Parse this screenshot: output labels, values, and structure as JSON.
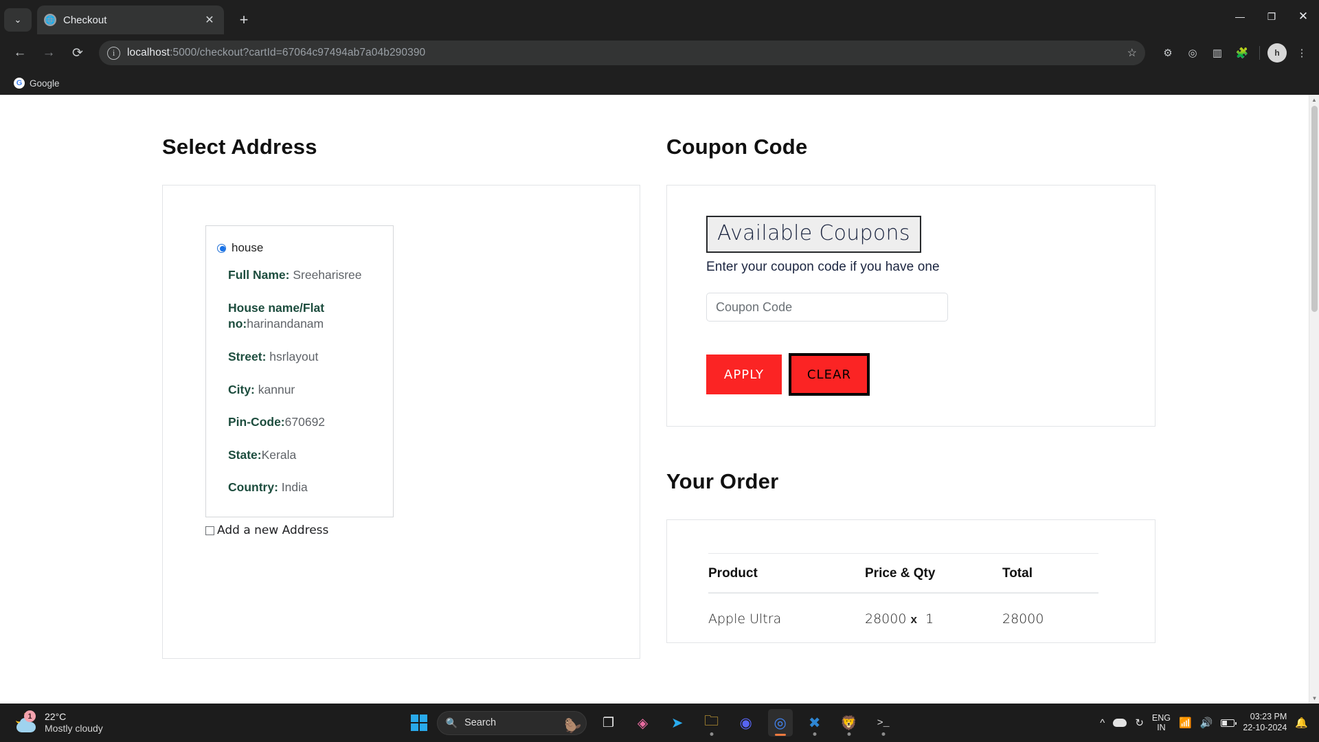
{
  "browser": {
    "tab": {
      "title": "Checkout",
      "favicon_icon": "globe-icon",
      "close_icon": "✕"
    },
    "tab_search_icon": "chevron-down-icon",
    "new_tab_icon": "+",
    "window_controls": {
      "minimize": "—",
      "maximize": "❐",
      "close": "✕"
    },
    "nav": {
      "back_icon": "←",
      "forward_icon": "→",
      "reload_icon": "⟳"
    },
    "omnibox": {
      "site_info_icon": "ⓘ",
      "url_host": "localhost",
      "url_rest": ":5000/checkout?cartId=67064c97494ab7a04b290390",
      "bookmark_star_icon": "☆"
    },
    "extensions": [
      "settings-gear-icon",
      "target-icon",
      "sidebar-icon",
      "puzzle-extensions-icon"
    ],
    "profile_initial": "h",
    "menu_icon": "⋮",
    "bookmarks": [
      {
        "label": "Google",
        "icon_letter": "G"
      }
    ]
  },
  "page": {
    "address": {
      "title": "Select Address",
      "option_label": "house",
      "selected": true,
      "fields": [
        {
          "label": "Full Name:",
          "value": " Sreeharisree"
        },
        {
          "label": "House name/Flat no:",
          "value": "harinandanam"
        },
        {
          "label": "Street:",
          "value": " hsrlayout"
        },
        {
          "label": "City:",
          "value": " kannur"
        },
        {
          "label": "Pin-Code:",
          "value": "670692"
        },
        {
          "label": "State:",
          "value": "Kerala"
        },
        {
          "label": "Country:",
          "value": " India"
        }
      ],
      "add_new_label": "Add a new Address",
      "add_new_checked": false
    },
    "coupon": {
      "title": "Coupon Code",
      "available_button": "Available Coupons",
      "hint": "Enter your coupon code if you have one",
      "input_value": "",
      "input_placeholder": "Coupon Code",
      "apply_label": "APPLY",
      "clear_label": "CLEAR",
      "apply_color": "#fb2424",
      "clear_color": "#fb2424"
    },
    "order": {
      "title": "Your Order",
      "columns": [
        "Product",
        "Price & Qty",
        "Total"
      ],
      "rows": [
        {
          "product": "Apple Ultra",
          "price": "28000",
          "x": "x",
          "qty": "1",
          "total": "28000"
        }
      ]
    }
  },
  "taskbar": {
    "weather": {
      "temp": "22°C",
      "condition": "Mostly cloudy",
      "badge": "1"
    },
    "start_icon": "windows-logo-icon",
    "search": {
      "placeholder": "Search",
      "icon": "search-icon",
      "mascot": "🦫"
    },
    "apps": [
      {
        "name": "task-view-icon",
        "glyph": "❐",
        "color": "#e8e8e8",
        "running": false
      },
      {
        "name": "microsoft-copilot-icon",
        "glyph": "◈",
        "color": "#f0a0c0",
        "running": false
      },
      {
        "name": "telegram-icon",
        "glyph": "➤",
        "color": "#2aabee",
        "running": false
      },
      {
        "name": "file-explorer-icon",
        "glyph": "🗀",
        "color": "#ffc83d",
        "running": true
      },
      {
        "name": "discord-icon",
        "glyph": "◉",
        "color": "#5865f2",
        "running": false
      },
      {
        "name": "google-chrome-icon",
        "glyph": "◎",
        "color": "#4285f4",
        "running": true
      },
      {
        "name": "vs-code-icon",
        "glyph": "✕",
        "color": "#2e86d3",
        "running": true
      },
      {
        "name": "brave-browser-icon",
        "glyph": "🦁",
        "color": "#fb542b",
        "running": true
      },
      {
        "name": "terminal-icon",
        "glyph": ">_",
        "color": "#dddddd",
        "running": true
      }
    ],
    "tray": {
      "overflow_icon": "^",
      "onedrive_icon": "cloud-icon",
      "sync_icon": "↻",
      "language": "ENG",
      "region": "IN",
      "wifi_icon": "wifi-icon",
      "volume_icon": "🔊",
      "battery_icon": "battery-icon",
      "time": "03:23 PM",
      "date": "22-10-2024",
      "notification_icon": "🔔"
    }
  }
}
